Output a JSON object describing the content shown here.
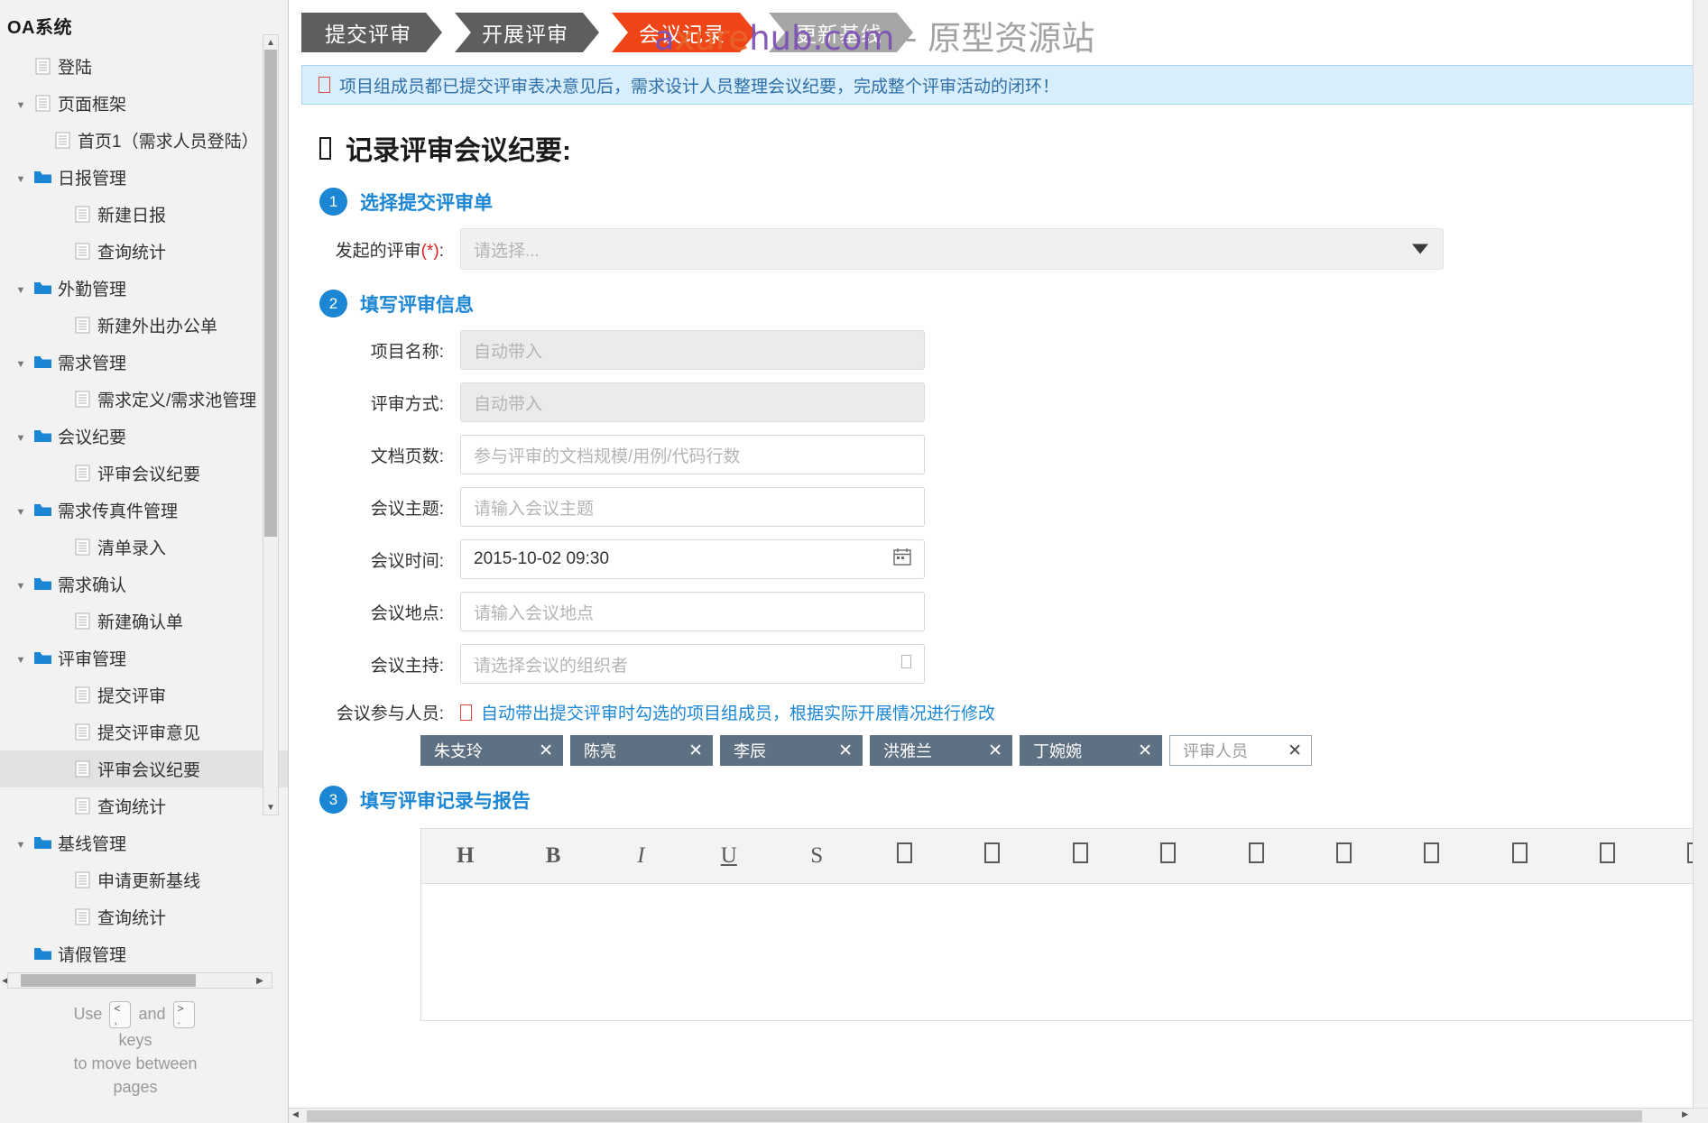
{
  "sidebar": {
    "title": "OA系统",
    "items": [
      {
        "label": "登陆",
        "level": 1,
        "icon": "page-icon",
        "caret": "",
        "selected": false
      },
      {
        "label": "页面框架",
        "level": 0,
        "icon": "page-icon",
        "caret": "▼",
        "selected": false
      },
      {
        "label": "首页1（需求人员登陆）",
        "level": 2,
        "icon": "page-icon",
        "caret": "",
        "selected": false
      },
      {
        "label": "日报管理",
        "level": 1,
        "icon": "folder-icon",
        "caret": "▼",
        "selected": false
      },
      {
        "label": "新建日报",
        "level": 3,
        "icon": "page-icon",
        "caret": "",
        "selected": false
      },
      {
        "label": "查询统计",
        "level": 3,
        "icon": "page-icon",
        "caret": "",
        "selected": false
      },
      {
        "label": "外勤管理",
        "level": 1,
        "icon": "folder-icon",
        "caret": "▼",
        "selected": false
      },
      {
        "label": "新建外出办公单",
        "level": 3,
        "icon": "page-icon",
        "caret": "",
        "selected": false
      },
      {
        "label": "需求管理",
        "level": 1,
        "icon": "folder-icon",
        "caret": "▼",
        "selected": false
      },
      {
        "label": "需求定义/需求池管理",
        "level": 3,
        "icon": "page-icon",
        "caret": "",
        "selected": false
      },
      {
        "label": "会议纪要",
        "level": 1,
        "icon": "folder-icon",
        "caret": "▼",
        "selected": false
      },
      {
        "label": "评审会议纪要",
        "level": 3,
        "icon": "page-icon",
        "caret": "",
        "selected": false
      },
      {
        "label": "需求传真件管理",
        "level": 1,
        "icon": "folder-icon",
        "caret": "▼",
        "selected": false
      },
      {
        "label": "清单录入",
        "level": 3,
        "icon": "page-icon",
        "caret": "",
        "selected": false
      },
      {
        "label": "需求确认",
        "level": 1,
        "icon": "folder-icon",
        "caret": "▼",
        "selected": false
      },
      {
        "label": "新建确认单",
        "level": 3,
        "icon": "page-icon",
        "caret": "",
        "selected": false
      },
      {
        "label": "评审管理",
        "level": 1,
        "icon": "folder-icon",
        "caret": "▼",
        "selected": false
      },
      {
        "label": "提交评审",
        "level": 3,
        "icon": "page-icon",
        "caret": "",
        "selected": false
      },
      {
        "label": "提交评审意见",
        "level": 3,
        "icon": "page-icon",
        "caret": "",
        "selected": false
      },
      {
        "label": "评审会议纪要",
        "level": 3,
        "icon": "page-icon",
        "caret": "",
        "selected": true
      },
      {
        "label": "查询统计",
        "level": 3,
        "icon": "page-icon",
        "caret": "",
        "selected": false
      },
      {
        "label": "基线管理",
        "level": 1,
        "icon": "folder-icon",
        "caret": "▼",
        "selected": false
      },
      {
        "label": "申请更新基线",
        "level": 3,
        "icon": "page-icon",
        "caret": "",
        "selected": false
      },
      {
        "label": "查询统计",
        "level": 3,
        "icon": "page-icon",
        "caret": "",
        "selected": false
      },
      {
        "label": "请假管理",
        "level": 1,
        "icon": "folder-icon",
        "caret": "",
        "selected": false
      }
    ],
    "help": {
      "use": "Use",
      "key_prev_top": "<",
      "key_prev_bottom": ",",
      "and": "and",
      "key_next_top": ">",
      "key_next_bottom": ".",
      "line2": "keys",
      "line3": "to move between",
      "line4": "pages"
    }
  },
  "watermark": {
    "a": "a",
    "x": "xure",
    "rest": "hub.com",
    "cn": " - 原型资源站"
  },
  "steps": [
    {
      "label": "提交评审",
      "state": "done"
    },
    {
      "label": "开展评审",
      "state": "done"
    },
    {
      "label": "会议记录",
      "state": "active"
    },
    {
      "label": "更新基线",
      "state": "upcoming"
    }
  ],
  "notice": {
    "text": "项目组成员都已提交评审表决意见后，需求设计人员整理会议纪要，完成整个评审活动的闭环！"
  },
  "page": {
    "title": "记录评审会议纪要:"
  },
  "sections": [
    {
      "num": "1",
      "title": "选择提交评审单"
    },
    {
      "num": "2",
      "title": "填写评审信息"
    },
    {
      "num": "3",
      "title": "填写评审记录与报告"
    }
  ],
  "form": {
    "review_select": {
      "label": "发起的评审",
      "required": "(*)",
      "colon": ":",
      "placeholder": "请选择..."
    },
    "fields": [
      {
        "label": "项目名称:",
        "value": "",
        "placeholder": "自动带入",
        "disabled": true
      },
      {
        "label": "评审方式:",
        "value": "",
        "placeholder": "自动带入",
        "disabled": true
      },
      {
        "label": "文档页数:",
        "value": "",
        "placeholder": "参与评审的文档规模/用例/代码行数",
        "disabled": false
      },
      {
        "label": "会议主题:",
        "value": "",
        "placeholder": "请输入会议主题",
        "disabled": false
      },
      {
        "label": "会议时间:",
        "value": "2015-10-02 09:30",
        "placeholder": "",
        "disabled": false
      },
      {
        "label": "会议地点:",
        "value": "",
        "placeholder": "请输入会议地点",
        "disabled": false
      },
      {
        "label": "会议主持:",
        "value": "",
        "placeholder": "请选择会议的组织者",
        "disabled": false
      }
    ],
    "participants": {
      "label": "会议参与人员:",
      "note": "自动带出提交评审时勾选的项目组成员，根据实际开展情况进行修改",
      "tags": [
        "朱支玲",
        "陈亮",
        "李辰",
        "洪雅兰",
        "丁婉婉"
      ],
      "new_placeholder": "评审人员",
      "remove_glyph": "✕"
    }
  },
  "editor": {
    "toolbar": [
      "H",
      "B",
      "I",
      "U",
      "S",
      "□",
      "□",
      "□",
      "□",
      "□",
      "□",
      "□",
      "□",
      "□",
      "□",
      "□"
    ]
  },
  "colors": {
    "accent_blue": "#1b86d4",
    "active_step": "#f04617",
    "done_step": "#5e5e5e",
    "upcoming_step": "#a6a6a6",
    "notice_bg": "#d9eefc",
    "tag_bg": "#5e7183"
  }
}
